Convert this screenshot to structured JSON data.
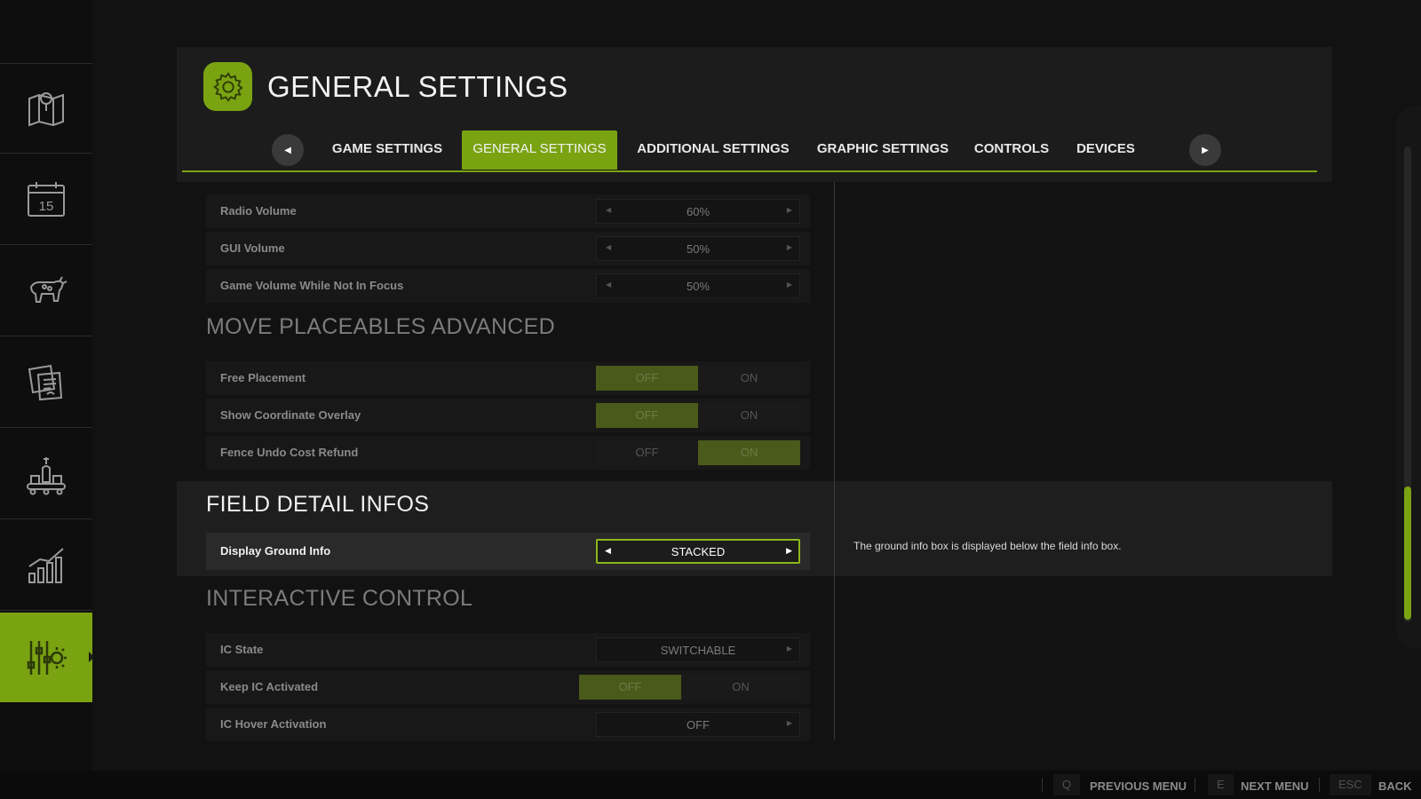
{
  "sidebar": {
    "items": [
      {
        "icon": "map-icon"
      },
      {
        "icon": "calendar-icon",
        "day": "15"
      },
      {
        "icon": "cow-icon"
      },
      {
        "icon": "contracts-icon"
      },
      {
        "icon": "production-icon"
      },
      {
        "icon": "statistics-icon"
      },
      {
        "icon": "settings-sliders-icon",
        "active": true
      }
    ]
  },
  "header": {
    "title": "GENERAL SETTINGS",
    "icon": "gear-icon",
    "tabs": [
      {
        "label": "GAME SETTINGS"
      },
      {
        "label": "GENERAL SETTINGS",
        "active": true
      },
      {
        "label": "ADDITIONAL SETTINGS"
      },
      {
        "label": "GRAPHIC SETTINGS"
      },
      {
        "label": "CONTROLS"
      },
      {
        "label": "DEVICES"
      }
    ]
  },
  "settings": {
    "radio_volume": {
      "label": "Radio Volume",
      "value": "60%"
    },
    "gui_volume": {
      "label": "GUI Volume",
      "value": "50%"
    },
    "game_volume_unfocused": {
      "label": "Game Volume While Not In Focus",
      "value": "50%"
    },
    "move_placeables": {
      "title": "MOVE PLACEABLES ADVANCED",
      "free_placement": {
        "label": "Free Placement",
        "off": "OFF",
        "on": "ON",
        "state": "OFF"
      },
      "show_coordinate_overlay": {
        "label": "Show Coordinate Overlay",
        "off": "OFF",
        "on": "ON",
        "state": "OFF"
      },
      "fence_undo_cost_refund": {
        "label": "Fence Undo Cost Refund",
        "off": "OFF",
        "on": "ON",
        "state": "ON"
      }
    },
    "field_detail_infos": {
      "title": "FIELD DETAIL INFOS",
      "display_ground_info": {
        "label": "Display Ground Info",
        "value": "STACKED"
      },
      "description": "The ground info box is displayed below the field info box."
    },
    "interactive_control": {
      "title": "INTERACTIVE CONTROL",
      "ic_state": {
        "label": "IC State",
        "value": "SWITCHABLE"
      },
      "keep_ic_activated": {
        "label": "Keep IC Activated",
        "off": "OFF",
        "on": "ON",
        "state": "OFF"
      },
      "ic_hover_activation": {
        "label": "IC Hover Activation",
        "value": "OFF"
      }
    }
  },
  "footer": {
    "prev": {
      "key": "Q",
      "label": "PREVIOUS MENU"
    },
    "next": {
      "key": "E",
      "label": "NEXT MENU"
    },
    "back": {
      "key": "ESC",
      "label": "BACK"
    }
  },
  "colors": {
    "accent": "#7aa312",
    "background": "#121212",
    "panel": "#1c1c1c"
  }
}
